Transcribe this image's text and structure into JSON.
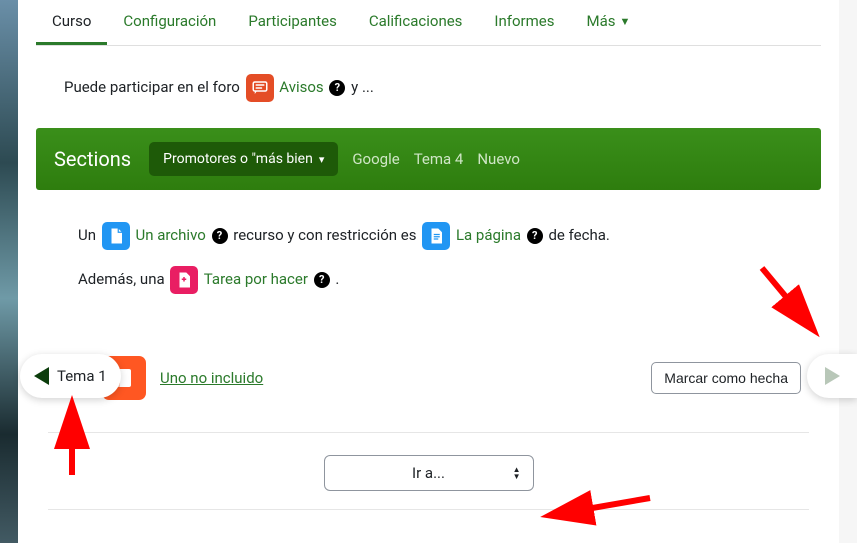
{
  "tabs": {
    "course": "Curso",
    "config": "Configuración",
    "participants": "Participantes",
    "grades": "Calificaciones",
    "reports": "Informes",
    "more": "Más"
  },
  "intro": {
    "prefix": "Puede participar en el foro ",
    "forum_link": "Avisos",
    "suffix": " y ..."
  },
  "sections": {
    "title": "Sections",
    "active": "Promotores o \"más bien",
    "items": [
      "Google",
      "Tema 4",
      "Nuevo"
    ]
  },
  "body": {
    "line1_a": "Un ",
    "line1_file": "Un archivo",
    "line1_b": " recurso y con restricción es ",
    "line1_page": "La página",
    "line1_c": " de fecha.",
    "line2_a": "Además, una ",
    "line2_assign": "Tarea por hacer",
    "line2_b": " ."
  },
  "activity": {
    "name": "Uno no incluido",
    "mark_done": "Marcar como hecha"
  },
  "nav": {
    "prev": "Tema 1",
    "jumpto": "Ir a..."
  }
}
